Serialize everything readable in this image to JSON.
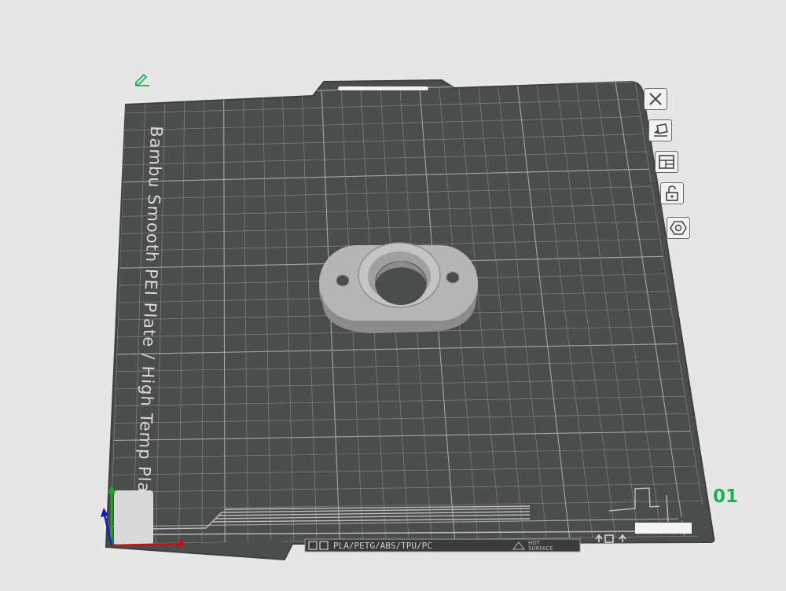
{
  "plate": {
    "label": "Bambu Smooth PEI Plate / High Temp Plate",
    "index": "01",
    "strip": {
      "materials": "PLA/PETG/ABS/TPU/PC",
      "hot_line1": "HOT",
      "hot_line2": "SURFACE"
    }
  },
  "toolbar": {
    "buttons": [
      {
        "name": "remove-plate-button",
        "icon": "close-icon"
      },
      {
        "name": "auto-orient-button",
        "icon": "auto-orient-icon"
      },
      {
        "name": "arrange-button",
        "icon": "arrange-icon"
      },
      {
        "name": "lock-plate-button",
        "icon": "lock-icon"
      },
      {
        "name": "plate-settings-button",
        "icon": "hex-nut-icon"
      }
    ]
  },
  "colors": {
    "background": "#e6e6e6",
    "plate": "#4a4d4c",
    "grid": "#8d9190",
    "model": "#a7a7a7",
    "index_green": "#19b34f",
    "axis_x": "#d01010",
    "axis_y": "#10b020",
    "axis_z": "#1020c0"
  }
}
